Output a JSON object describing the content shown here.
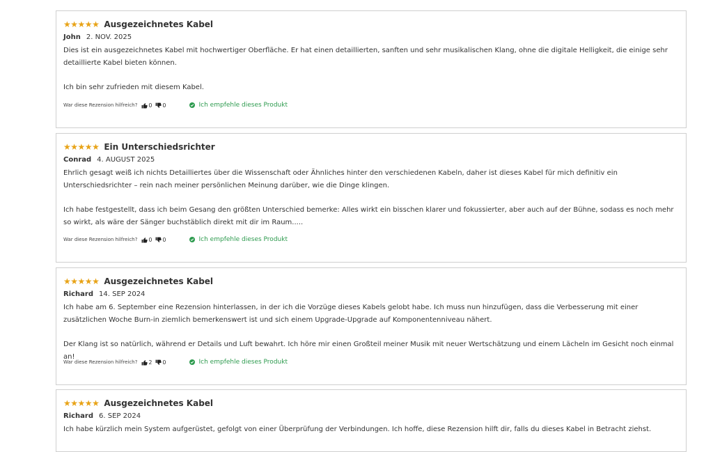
{
  "helpful_question": "War diese Rezension hilfreich?",
  "recommend_text": "Ich empfehle dieses Produkt",
  "colors": {
    "star": "#e8a317",
    "recommend": "#2e9b4f",
    "border": "#cfcfcf"
  },
  "reviews": [
    {
      "stars": 5,
      "title": "Ausgezeichnetes Kabel",
      "author": "John",
      "date": "2. NOV. 2025",
      "paragraphs": [
        "Dies ist ein ausgezeichnetes Kabel mit hochwertiger Oberfläche. Er hat einen detaillierten, sanften und sehr musikalischen Klang, ohne die digitale Helligkeit, die einige sehr detaillierte Kabel bieten können.",
        "Ich bin sehr zufrieden mit diesem Kabel."
      ],
      "up": "0",
      "down": "0"
    },
    {
      "stars": 5,
      "title": "Ein Unterschiedsrichter",
      "author": "Conrad",
      "date": "4. AUGUST 2025",
      "paragraphs": [
        "Ehrlich gesagt weiß ich nichts Detailliertes über die Wissenschaft oder Ähnliches hinter den verschiedenen Kabeln, daher ist dieses Kabel für mich definitiv ein Unterschiedsrichter – rein nach meiner persönlichen Meinung darüber, wie die Dinge klingen.",
        "Ich habe festgestellt, dass ich beim Gesang den größten Unterschied bemerke: Alles wirkt ein bisschen klarer und fokussierter, aber auch auf der Bühne, sodass es noch mehr so wirkt, als wäre der Sänger buchstäblich direkt mit dir im Raum....."
      ],
      "up": "0",
      "down": "0"
    },
    {
      "stars": 5,
      "title": "Ausgezeichnetes Kabel",
      "author": "Richard",
      "date": "14. SEP 2024",
      "paragraphs": [
        "Ich habe am 6. September eine Rezension hinterlassen, in der ich die Vorzüge dieses Kabels gelobt habe. Ich muss nun hinzufügen, dass die Verbesserung mit einer zusätzlichen Woche Burn-in ziemlich bemerkenswert ist und sich einem Upgrade-Upgrade auf Komponentenniveau nähert.",
        "Der Klang ist so natürlich, während er Details und Luft bewahrt. Ich höre mir einen Großteil meiner Musik mit neuer Wertschätzung und einem Lächeln im Gesicht noch einmal an!"
      ],
      "up": "2",
      "down": "0"
    },
    {
      "stars": 5,
      "title": "Ausgezeichnetes Kabel",
      "author": "Richard",
      "date": "6. SEP 2024",
      "paragraphs": [
        "Ich habe kürzlich mein System aufgerüstet, gefolgt von einer Überprüfung der Verbindungen. Ich hoffe, diese Rezension hilft dir, falls du dieses Kabel in Betracht ziehst."
      ],
      "up": "",
      "down": ""
    }
  ]
}
